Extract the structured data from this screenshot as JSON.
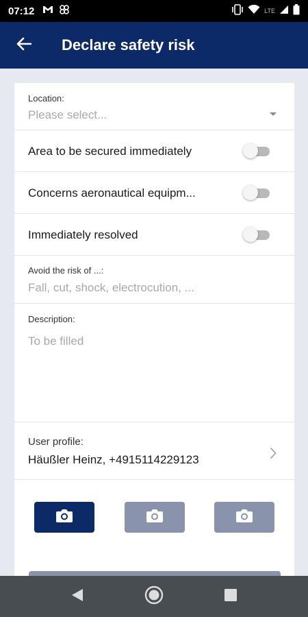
{
  "status_bar": {
    "time": "07:12",
    "left_icons": [
      "gmail-icon",
      "pinwheel-icon"
    ],
    "right_icons": [
      "vibrate-icon",
      "wifi-icon",
      "lte-signal-icon",
      "battery-icon"
    ],
    "network": "LTE"
  },
  "app_bar": {
    "title": "Declare safety risk",
    "back_icon": "arrow-left-icon",
    "background": "#0d2a68"
  },
  "form": {
    "location": {
      "label": "Location:",
      "placeholder": "Please select..."
    },
    "toggles": [
      {
        "label": "Area to be secured immediately",
        "on": false
      },
      {
        "label": "Concerns aeronautical equipm...",
        "on": false
      },
      {
        "label": "Immediately resolved",
        "on": false
      }
    ],
    "avoid": {
      "label": "Avoid the risk of ...:",
      "placeholder": "Fall, cut, shock, electrocution, ..."
    },
    "description": {
      "label": "Description:",
      "placeholder": "To be filled"
    },
    "user_profile": {
      "label": "User profile:",
      "value": "Häußler Heinz, +4915114229123"
    },
    "photo_buttons": [
      {
        "icon": "camera-icon",
        "state": "active"
      },
      {
        "icon": "camera-icon",
        "state": "inactive"
      },
      {
        "icon": "camera-icon",
        "state": "inactive"
      }
    ]
  },
  "colors": {
    "primary": "#0d2a68",
    "inactive_button": "#8993ab",
    "background": "#e6eaf0",
    "nav_bar": "#474d51"
  },
  "nav_bar": {
    "buttons": [
      "back-triangle-icon",
      "home-circle-icon",
      "recents-square-icon"
    ]
  }
}
